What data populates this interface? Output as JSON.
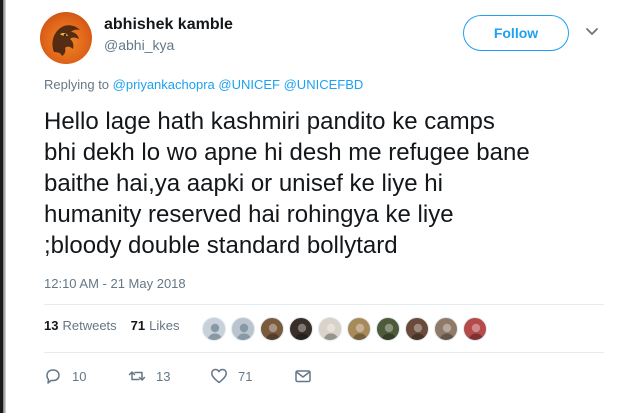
{
  "user": {
    "display_name": "abhishek kamble",
    "handle": "@abhi_kya"
  },
  "follow_button": {
    "label": "Follow"
  },
  "reply": {
    "prefix": "Replying to",
    "mentions": [
      "@priyankachopra",
      "@UNICEF",
      "@UNICEFBD"
    ]
  },
  "tweet": {
    "lines": [
      "Hello lage hath kashmiri pandito ke camps",
      "bhi dekh lo wo apne hi desh me refugee bane",
      "baithe hai,ya aapki or unisef ke liye hi",
      "humanity reserved hai rohingya ke liye",
      ";bloody double standard bollytard"
    ],
    "timestamp": "12:10 AM - 21 May 2018"
  },
  "stats": {
    "retweets_count": "13",
    "retweets_label": "Retweets",
    "likes_count": "71",
    "likes_label": "Likes"
  },
  "likers": [
    {
      "icon": "default-avatar-icon",
      "color": "#c8d1da"
    },
    {
      "icon": "default-avatar-icon",
      "color": "#b9c4cf"
    },
    {
      "icon": "user-avatar-icon",
      "color": "#7a5a3c"
    },
    {
      "icon": "user-avatar-icon",
      "color": "#3a2e28"
    },
    {
      "icon": "user-avatar-icon",
      "color": "#d8d2c8"
    },
    {
      "icon": "user-avatar-icon",
      "color": "#a88a5a"
    },
    {
      "icon": "user-avatar-icon",
      "color": "#4e5a3a"
    },
    {
      "icon": "user-avatar-icon",
      "color": "#6a4a3a"
    },
    {
      "icon": "user-avatar-icon",
      "color": "#8f7a6a"
    },
    {
      "icon": "user-avatar-icon",
      "color": "#b44a4a"
    }
  ],
  "actions": {
    "replies": "10",
    "retweets": "13",
    "likes": "71"
  },
  "colors": {
    "accent": "#1da1f2",
    "secondary_text": "#657786",
    "primary_text": "#14171a"
  }
}
